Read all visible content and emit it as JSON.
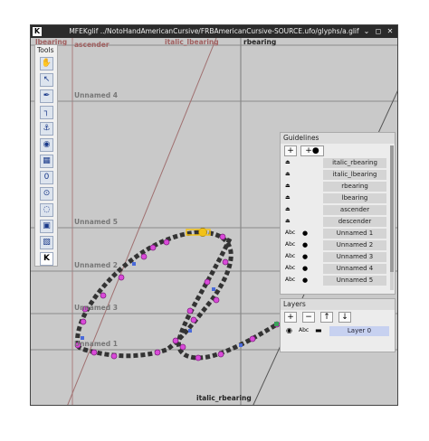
{
  "window": {
    "app_icon": "K",
    "title": "MFEKglif ../NotoHandAmericanCursive/FRBAmericanCursive-SOURCE.ufo/glyphs/a.glif",
    "minimize_glyph": "⌄",
    "maximize_glyph": "◻",
    "close_glyph": "✕"
  },
  "canvas": {
    "guide_labels": {
      "lbearing": "lbearing",
      "ascender": "ascender",
      "italic_lbearing": "italic_lbearing",
      "rbearing": "rbearing",
      "unnamed4": "Unnamed 4",
      "unnamed5": "Unnamed 5",
      "unnamed2": "Unnamed 2",
      "unnamed3": "Unnamed 3",
      "unnamed1": "Unnamed 1",
      "italic_rbearing": "italic_rbearing"
    }
  },
  "tools": {
    "header": "Tools",
    "items": [
      {
        "name": "pan-hand-icon",
        "glyph": "✋"
      },
      {
        "name": "select-arrow-icon",
        "glyph": "↖"
      },
      {
        "name": "pen-icon",
        "glyph": "✒"
      },
      {
        "name": "measure-icon",
        "glyph": "┐"
      },
      {
        "name": "anchor-icon",
        "glyph": "⚓"
      },
      {
        "name": "shapes-icon",
        "glyph": "◉"
      },
      {
        "name": "grid-icon",
        "glyph": "▦"
      },
      {
        "name": "variable-width-icon",
        "glyph": "0"
      },
      {
        "name": "pap-icon",
        "glyph": "⊙"
      },
      {
        "name": "dash-icon",
        "glyph": "◌"
      },
      {
        "name": "image-icon",
        "glyph": "▣"
      },
      {
        "name": "guidelines-tool-icon",
        "glyph": "▧"
      },
      {
        "name": "metrics-icon",
        "glyph": "K"
      }
    ]
  },
  "guidelines": {
    "header": "Guidelines",
    "add_label": "+",
    "add_global_label": "+●",
    "rows": [
      {
        "left_icon": "⏏",
        "globe": "",
        "name": "italic_rbearing"
      },
      {
        "left_icon": "⏏",
        "globe": "",
        "name": "italic_lbearing"
      },
      {
        "left_icon": "⏏",
        "globe": "",
        "name": "rbearing"
      },
      {
        "left_icon": "⏏",
        "globe": "",
        "name": "lbearing"
      },
      {
        "left_icon": "⏏",
        "globe": "",
        "name": "ascender"
      },
      {
        "left_icon": "⏏",
        "globe": "",
        "name": "descender"
      },
      {
        "left_icon": "Abc",
        "globe": "●",
        "name": "Unnamed 1"
      },
      {
        "left_icon": "Abc",
        "globe": "●",
        "name": "Unnamed 2"
      },
      {
        "left_icon": "Abc",
        "globe": "●",
        "name": "Unnamed 3"
      },
      {
        "left_icon": "Abc",
        "globe": "●",
        "name": "Unnamed 4"
      },
      {
        "left_icon": "Abc",
        "globe": "●",
        "name": "Unnamed 5"
      }
    ]
  },
  "layers": {
    "header": "Layers",
    "add_label": "+",
    "remove_label": "−",
    "up_label": "↑",
    "down_label": "↓",
    "row": {
      "eye": "◉",
      "abc": "Abc",
      "fill": "▬",
      "name": "Layer 0"
    }
  },
  "colors": {
    "canvas": "#c9c9c9",
    "outline_point": "#d94ad9",
    "selected_point": "#f2c218",
    "layer_highlight": "#c7d1f0"
  }
}
